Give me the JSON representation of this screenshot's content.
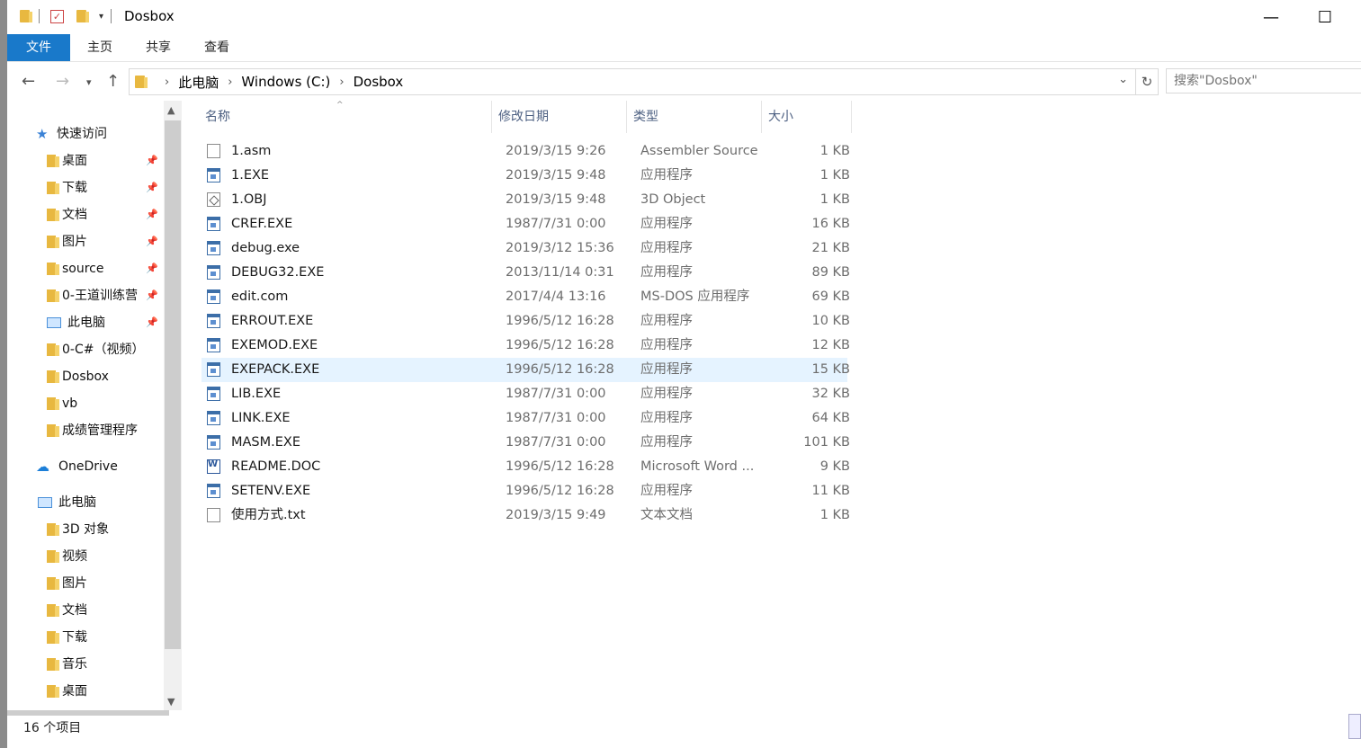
{
  "window": {
    "title": "Dosbox"
  },
  "ribbon": {
    "tabs": [
      "文件",
      "主页",
      "共享",
      "查看"
    ]
  },
  "address": {
    "crumbs": [
      "此电脑",
      "Windows (C:)",
      "Dosbox"
    ],
    "search_placeholder": "搜索\"Dosbox\""
  },
  "navpane": {
    "items": [
      {
        "label": "快速访问",
        "icon": "star-icon",
        "pinned": false
      },
      {
        "label": "桌面",
        "icon": "desktop-folder-icon",
        "pinned": true
      },
      {
        "label": "下载",
        "icon": "download-folder-icon",
        "pinned": true
      },
      {
        "label": "文档",
        "icon": "documents-folder-icon",
        "pinned": true
      },
      {
        "label": "图片",
        "icon": "pictures-folder-icon",
        "pinned": true
      },
      {
        "label": "source",
        "icon": "folder-icon",
        "pinned": true
      },
      {
        "label": "0-王道训练营",
        "icon": "folder-icon",
        "pinned": true
      },
      {
        "label": "此电脑",
        "icon": "computer-icon",
        "pinned": true
      },
      {
        "label": "0-C#（视频）",
        "icon": "folder-icon",
        "pinned": false
      },
      {
        "label": "Dosbox",
        "icon": "folder-icon",
        "pinned": false
      },
      {
        "label": "vb",
        "icon": "folder-icon",
        "pinned": false
      },
      {
        "label": "成绩管理程序",
        "icon": "folder-icon",
        "pinned": false
      },
      {
        "label": "OneDrive",
        "icon": "cloud-icon",
        "pinned": false
      },
      {
        "label": "此电脑",
        "icon": "computer-icon",
        "pinned": false
      },
      {
        "label": "3D 对象",
        "icon": "3d-objects-folder-icon",
        "pinned": false
      },
      {
        "label": "视频",
        "icon": "videos-folder-icon",
        "pinned": false
      },
      {
        "label": "图片",
        "icon": "pictures-folder-icon",
        "pinned": false
      },
      {
        "label": "文档",
        "icon": "documents-folder-icon",
        "pinned": false
      },
      {
        "label": "下载",
        "icon": "download-folder-icon",
        "pinned": false
      },
      {
        "label": "音乐",
        "icon": "music-folder-icon",
        "pinned": false
      },
      {
        "label": "桌面",
        "icon": "desktop-folder-icon",
        "pinned": false
      }
    ]
  },
  "columns": {
    "name": "名称",
    "date": "修改日期",
    "type": "类型",
    "size": "大小"
  },
  "files": [
    {
      "name": "1.asm",
      "date": "2019/3/15 9:26",
      "type": "Assembler Source",
      "size": "1 KB",
      "icon": "doc"
    },
    {
      "name": "1.EXE",
      "date": "2019/3/15 9:48",
      "type": "应用程序",
      "size": "1 KB",
      "icon": "exe"
    },
    {
      "name": "1.OBJ",
      "date": "2019/3/15 9:48",
      "type": "3D Object",
      "size": "1 KB",
      "icon": "obj"
    },
    {
      "name": "CREF.EXE",
      "date": "1987/7/31 0:00",
      "type": "应用程序",
      "size": "16 KB",
      "icon": "exe"
    },
    {
      "name": "debug.exe",
      "date": "2019/3/12 15:36",
      "type": "应用程序",
      "size": "21 KB",
      "icon": "exe"
    },
    {
      "name": "DEBUG32.EXE",
      "date": "2013/11/14 0:31",
      "type": "应用程序",
      "size": "89 KB",
      "icon": "exe"
    },
    {
      "name": "edit.com",
      "date": "2017/4/4 13:16",
      "type": "MS-DOS 应用程序",
      "size": "69 KB",
      "icon": "exe"
    },
    {
      "name": "ERROUT.EXE",
      "date": "1996/5/12 16:28",
      "type": "应用程序",
      "size": "10 KB",
      "icon": "exe"
    },
    {
      "name": "EXEMOD.EXE",
      "date": "1996/5/12 16:28",
      "type": "应用程序",
      "size": "12 KB",
      "icon": "exe"
    },
    {
      "name": "EXEPACK.EXE",
      "date": "1996/5/12 16:28",
      "type": "应用程序",
      "size": "15 KB",
      "icon": "exe",
      "selected": true
    },
    {
      "name": "LIB.EXE",
      "date": "1987/7/31 0:00",
      "type": "应用程序",
      "size": "32 KB",
      "icon": "exe"
    },
    {
      "name": "LINK.EXE",
      "date": "1987/7/31 0:00",
      "type": "应用程序",
      "size": "64 KB",
      "icon": "exe"
    },
    {
      "name": "MASM.EXE",
      "date": "1987/7/31 0:00",
      "type": "应用程序",
      "size": "101 KB",
      "icon": "exe"
    },
    {
      "name": "README.DOC",
      "date": "1996/5/12 16:28",
      "type": "Microsoft Word ...",
      "size": "9 KB",
      "icon": "word"
    },
    {
      "name": "SETENV.EXE",
      "date": "1996/5/12 16:28",
      "type": "应用程序",
      "size": "11 KB",
      "icon": "exe"
    },
    {
      "name": "使用方式.txt",
      "date": "2019/3/15 9:49",
      "type": "文本文档",
      "size": "1 KB",
      "icon": "doc"
    }
  ],
  "status": {
    "count": "16 个项目"
  }
}
